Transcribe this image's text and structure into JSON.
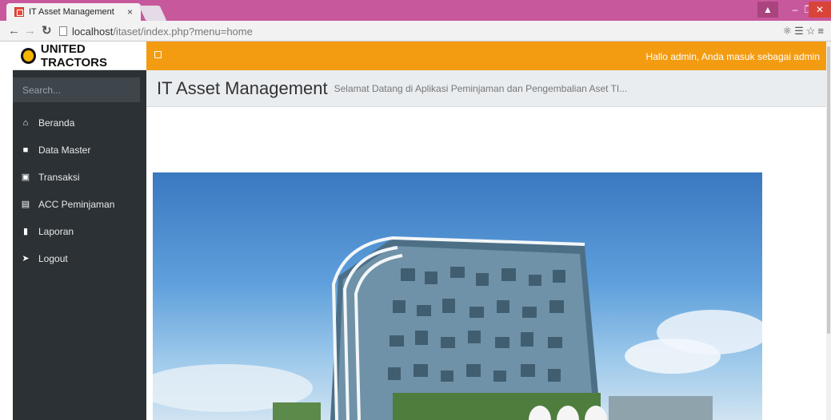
{
  "browser": {
    "tab_title": "IT Asset Management",
    "tab_close": "×",
    "url_host": "localhost",
    "url_path": "/itaset/index.php?menu=home"
  },
  "app": {
    "brand": "UNITED TRACTORS",
    "search_placeholder": "Search...",
    "greeting": "Hallo admin, Anda masuk sebagai admin",
    "page_title": "IT Asset Management",
    "page_subtitle": "Selamat Datang di Aplikasi Peminjaman dan Pengembalian Aset TI...",
    "menu": [
      {
        "label": "Beranda",
        "icon": "home-icon"
      },
      {
        "label": "Data Master",
        "icon": "lock-icon"
      },
      {
        "label": "Transaksi",
        "icon": "briefcase-icon"
      },
      {
        "label": "ACC Peminjaman",
        "icon": "list-icon"
      },
      {
        "label": "Laporan",
        "icon": "book-icon"
      },
      {
        "label": "Logout",
        "icon": "logout-icon"
      }
    ]
  },
  "colors": {
    "accent": "#f39c12",
    "sidebar": "#2b3135",
    "chrome": "#c8589c"
  }
}
